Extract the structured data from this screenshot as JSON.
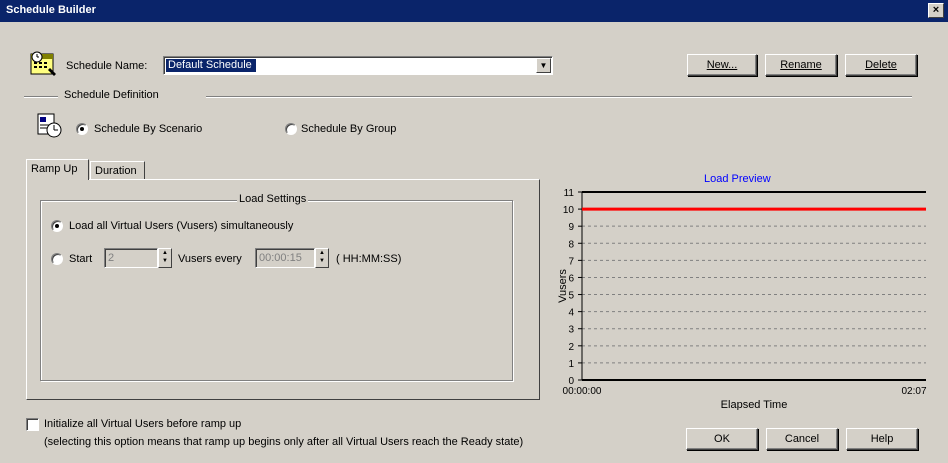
{
  "window": {
    "title": "Schedule Builder",
    "close_glyph": "×"
  },
  "schedule": {
    "name_label": "Schedule Name:",
    "selected_name": "Default Schedule",
    "buttons": {
      "new": "New...",
      "rename": "Rename",
      "delete": "Delete"
    }
  },
  "definition": {
    "section_label": "Schedule Definition",
    "by_scenario_label": "Schedule By Scenario",
    "by_group_label": "Schedule By Group",
    "selected": "by_scenario"
  },
  "tabs": [
    {
      "label": "Ramp Up",
      "active": true
    },
    {
      "label": "Duration",
      "active": false
    }
  ],
  "load_settings": {
    "group_title": "Load Settings",
    "option_all": "Load all Virtual Users (Vusers) simultaneously",
    "option_start_prefix": "Start",
    "start_count": "2",
    "vusers_every": "Vusers every",
    "interval": "00:00:15",
    "format_hint": "( HH:MM:SS)",
    "selected": "all"
  },
  "chart": {
    "title": "Load Preview",
    "ylabel": "Vusers",
    "xlabel": "Elapsed Time",
    "x_start_label": "00:00:00",
    "x_end_label": "02:07",
    "title_color": "#0000ff",
    "series_color": "#ff0000"
  },
  "chart_data": {
    "type": "line",
    "title": "Load Preview",
    "xlabel": "Elapsed Time",
    "ylabel": "Vusers",
    "ylim": [
      0,
      11
    ],
    "yticks": [
      0,
      1,
      2,
      3,
      4,
      5,
      6,
      7,
      8,
      9,
      10,
      11
    ],
    "ytick_labels": [
      "0",
      "1",
      "2",
      "3",
      "4",
      "5",
      "6",
      "7",
      "8",
      "9",
      "10",
      "11"
    ],
    "xtick_labels": [
      "00:00:00",
      "02:07"
    ],
    "series": [
      {
        "x": [
          "00:00:00",
          "02:07"
        ],
        "values": [
          10,
          10
        ]
      }
    ],
    "grid": true
  },
  "initialize": {
    "checkbox_label": "Initialize all Virtual Users before ramp up",
    "note": "(selecting this option means that ramp up begins only after all Virtual Users reach the Ready state)",
    "checked": false
  },
  "footer": {
    "ok": "OK",
    "cancel": "Cancel",
    "help": "Help"
  }
}
